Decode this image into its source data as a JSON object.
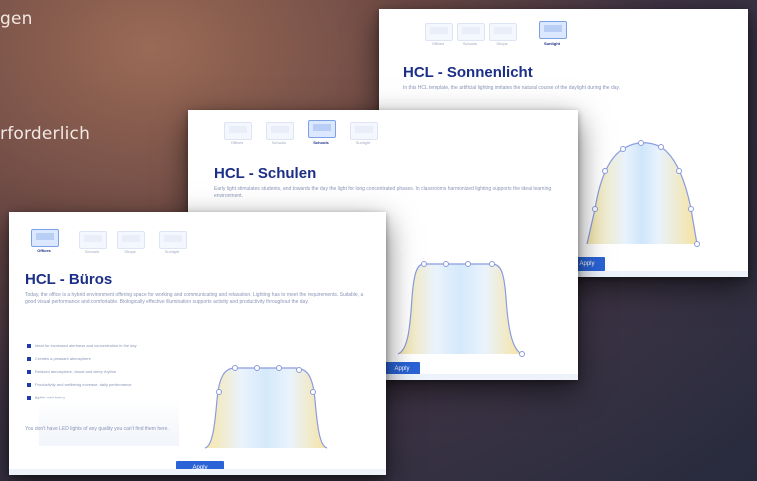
{
  "background": {
    "text_line1": "gen",
    "text_line2": "rforderlich"
  },
  "cards": [
    {
      "title": "HCL - Sonnenlicht",
      "subtitle": "In this HCL template, the artificial lighting imitates the natural course of the daylight during the day.",
      "tabs": [
        "Offices",
        "Schools",
        "Shops",
        "Sunlight"
      ],
      "active_tab": 3,
      "button_label": "Apply"
    },
    {
      "title": "HCL - Schulen",
      "subtitle": "Early light stimulates students, and towards the day the light for long concentrated phases. In classrooms harmonized lighting supports the ideal learning environment.",
      "tabs": [
        "Offices",
        "Schools",
        "Schools",
        "Sunlight"
      ],
      "active_tab": 2,
      "button_label": "Apply"
    },
    {
      "title": "HCL - Büros",
      "subtitle": "Today, the office is a hybrid environment offering space for working and communicating and relaxation. Lighting has to meet the requirements. Suitable, a good visual performance and comfortable. Biologically effective illumination supports activity and productivity throughout the day.",
      "tabs": [
        "Offices",
        "Schools",
        "Shops",
        "Sunlight"
      ],
      "active_tab": 0,
      "bullets": [
        "Ideal for increased alertness and concentration in the day",
        "Creates a pleasant atmosphere",
        "Relaxed atmosphere, visual and sleep rhythm",
        "Productivity and wellbeing increase, daily performance",
        "Better well-being"
      ],
      "footer_note": "You don't have LED lights of any quality you can't find them here.",
      "button_label": "Apply"
    }
  ],
  "colors": {
    "title": "#1c2f87",
    "button": "#2a63d6",
    "curve": "#8a9be0"
  }
}
